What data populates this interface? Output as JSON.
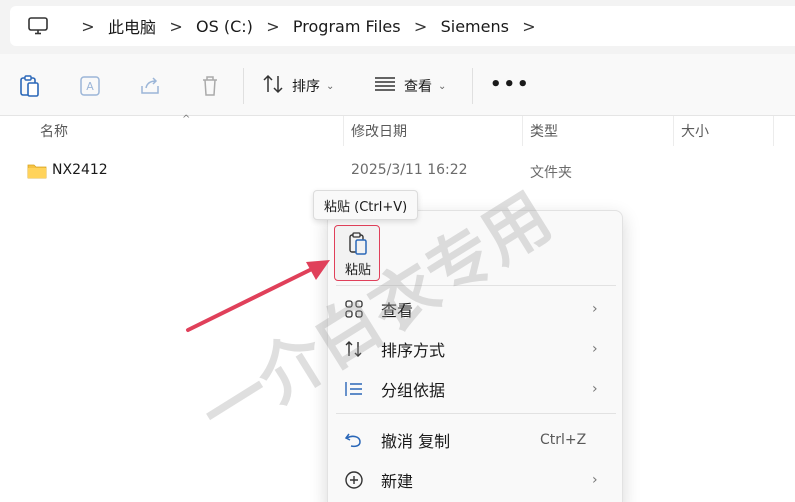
{
  "address": {
    "crumbs": [
      "此电脑",
      "OS (C:)",
      "Program Files",
      "Siemens"
    ],
    "separator": ">"
  },
  "toolbar": {
    "copy_icon": "clipboard-icon",
    "rename_icon": "rename-icon",
    "share_icon": "share-icon",
    "delete_icon": "trash-icon",
    "sort_label": "排序",
    "view_label": "查看",
    "more_label": "•••"
  },
  "columns": {
    "name": "名称",
    "modified": "修改日期",
    "type": "类型",
    "size": "大小"
  },
  "files": [
    {
      "name": "NX2412",
      "modified": "2025/3/11 16:22",
      "type": "文件夹"
    }
  ],
  "tooltip": "粘贴 (Ctrl+V)",
  "context_menu": {
    "paste_label": "粘贴",
    "items": [
      {
        "label": "查看",
        "icon": "grid-icon",
        "submenu": true
      },
      {
        "label": "排序方式",
        "icon": "sort-icon",
        "submenu": true
      },
      {
        "label": "分组依据",
        "icon": "group-icon",
        "submenu": true
      },
      {
        "label": "撤消 复制",
        "icon": "undo-icon",
        "shortcut": "Ctrl+Z"
      },
      {
        "label": "新建",
        "icon": "new-icon",
        "submenu": true
      }
    ]
  },
  "watermark": "一介白衣专用",
  "colors": {
    "accent_red": "#e0405a",
    "folder": "#f6c343",
    "icon_blue": "#2a67b8"
  }
}
